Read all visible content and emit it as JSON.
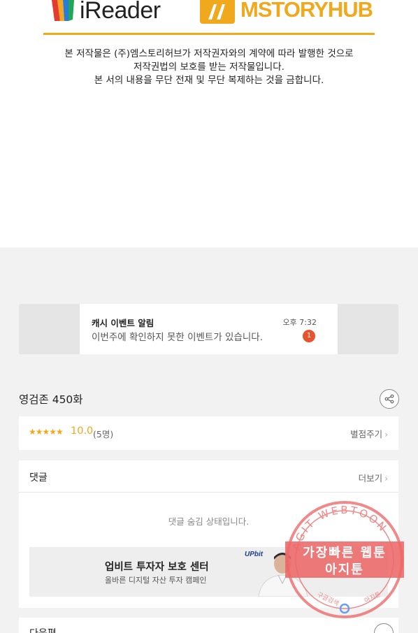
{
  "logos": {
    "ireader": "iReader",
    "mstoryhub": "MSTORYHUB"
  },
  "copyright": {
    "line1": "본 저작물은 (주)엠스토리허브가 저작권자와의 계약에 따라 발행한 것으로",
    "line2": "저작권법의 보호를 받는 저작물입니다.",
    "line3": "본 서의 내용을 무단 전재 및 무단 복제하는 것을 금합니다."
  },
  "notification": {
    "title": "캐시 이벤트 알림",
    "time": "오후 7:32",
    "body": "이번주에 확인하지 못한 이벤트가 있습니다.",
    "count": "1"
  },
  "episode": {
    "title": "영검존 450화"
  },
  "rating": {
    "stars": "★★★★★",
    "score": "10.0",
    "count": "(5명)",
    "rate_label": "별점주기"
  },
  "comments": {
    "label": "댓글",
    "more_label": "더보기",
    "hidden_message": "댓글 숨김 상태입니다."
  },
  "ad": {
    "title": "업비트 투자자 보호 센터",
    "subtitle": "올바른 디지털 자산 투자 캠페인",
    "brand": "UPbit"
  },
  "next": {
    "label": "다음편"
  },
  "watermark": {
    "ring_text": "AGIT WEBTOON",
    "line1": "가장빠른 웹툰",
    "line2": "아지툰",
    "bottom_left": "구글검색",
    "bottom_right": "아지툰"
  },
  "colors": {
    "brand_orange": "#f0a81c",
    "badge_red": "#e8532e",
    "watermark_red": "#ec6868",
    "upbit_blue": "#1f3c8e"
  }
}
